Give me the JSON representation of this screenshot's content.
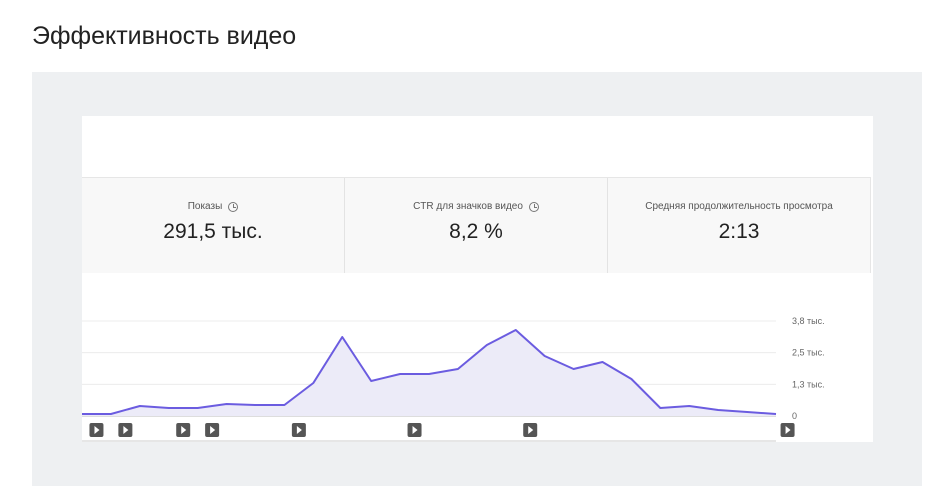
{
  "title": "Эффективность видео",
  "metrics": [
    {
      "label": "Показы",
      "value": "291,5 тыс.",
      "icon": "clock-icon"
    },
    {
      "label": "CTR для значков видео",
      "value": "8,2 %",
      "icon": "clock-icon"
    },
    {
      "label": "Средняя продолжительность просмотра",
      "value": "2:13"
    }
  ],
  "chart_data": {
    "type": "area",
    "color": "#6b5ce0",
    "fill": "#ecebf8",
    "ylim": [
      0,
      3800
    ],
    "yticks": [
      {
        "v": 0,
        "label": "0"
      },
      {
        "v": 1266,
        "label": "1,3 тыс."
      },
      {
        "v": 2533,
        "label": "2,5 тыс."
      },
      {
        "v": 3800,
        "label": "3,8 тыс."
      }
    ],
    "values": [
      80,
      80,
      400,
      320,
      320,
      480,
      440,
      440,
      1320,
      3160,
      1400,
      1680,
      1680,
      1880,
      2840,
      3440,
      2400,
      1880,
      2160,
      1480,
      320,
      400,
      240,
      160,
      80
    ],
    "video_markers": [
      0.5,
      1.5,
      3.5,
      4.5,
      7.5,
      11.5,
      15.5,
      24.4
    ]
  }
}
